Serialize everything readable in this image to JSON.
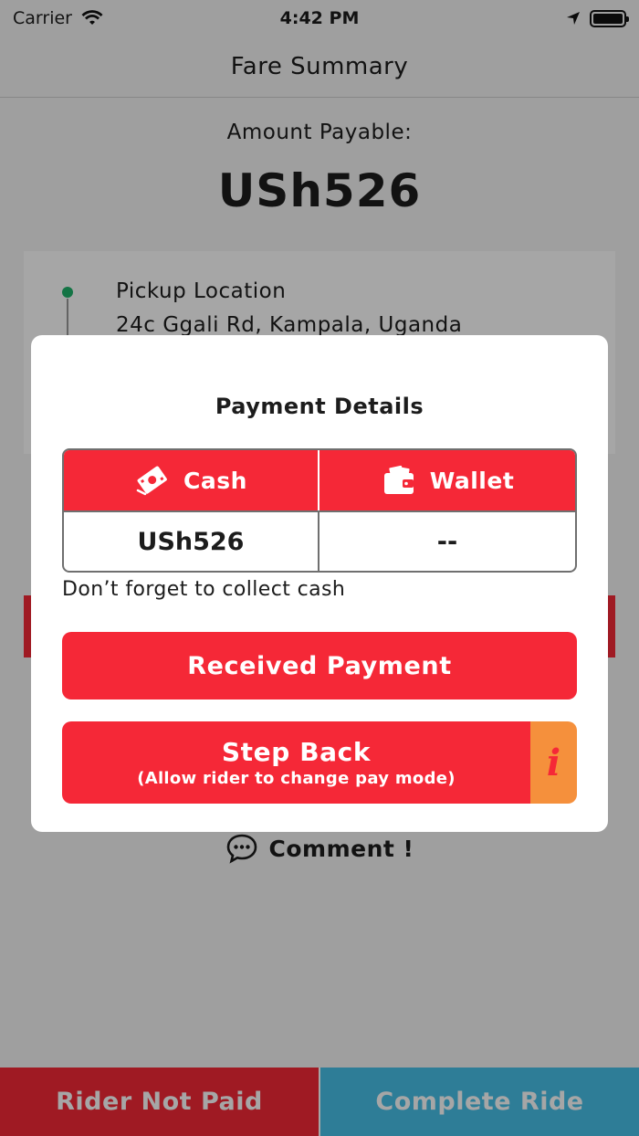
{
  "status_bar": {
    "carrier": "Carrier",
    "time": "4:42 PM"
  },
  "nav": {
    "title": "Fare Summary"
  },
  "summary": {
    "amount_label": "Amount Payable:",
    "amount_value": "USh526"
  },
  "location": {
    "pickup_title": "Pickup Location",
    "pickup_address": "24c Ggali Rd, Kampala, Uganda"
  },
  "comment": {
    "label": "Comment !"
  },
  "bottom": {
    "not_paid_label": "Rider Not Paid",
    "complete_label": "Complete Ride"
  },
  "modal": {
    "title": "Payment Details",
    "cash_header": "Cash",
    "wallet_header": "Wallet",
    "cash_value": "USh526",
    "wallet_value": "--",
    "note": "Don’t forget to collect cash",
    "received_label": "Received Payment",
    "stepback_title": "Step Back",
    "stepback_sub": "(Allow rider to change pay mode)",
    "info_glyph": "i"
  },
  "colors": {
    "accent_red": "#f52837",
    "info_orange": "#f5903c",
    "complete_blue": "#47c0e9",
    "pickup_green": "#1fb36a"
  }
}
